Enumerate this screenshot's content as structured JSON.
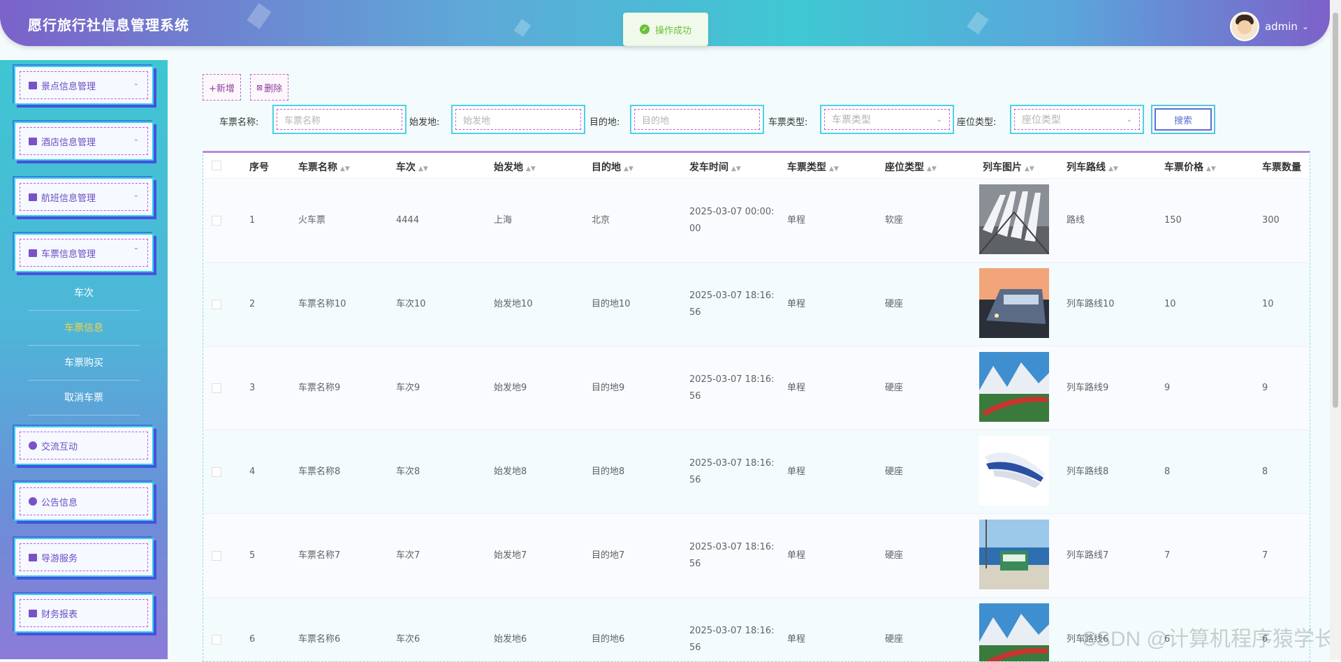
{
  "header": {
    "title": "愿行旅行社信息管理系统",
    "username": "admin"
  },
  "toast": {
    "message": "操作成功"
  },
  "sidebar": {
    "menus": [
      {
        "label": "景点信息管理"
      },
      {
        "label": "酒店信息管理"
      },
      {
        "label": "航班信息管理"
      },
      {
        "label": "车票信息管理"
      }
    ],
    "submenu": [
      "车次",
      "车票信息",
      "车票购买",
      "取消车票"
    ],
    "menus_bottom": [
      {
        "label": "交流互动"
      },
      {
        "label": "公告信息"
      },
      {
        "label": "导游服务"
      },
      {
        "label": "财务报表"
      }
    ]
  },
  "toolbar": {
    "add_label": "+新增",
    "delete_label": "删除"
  },
  "search": {
    "ticket_name_label": "车票名称:",
    "ticket_name_placeholder": "车票名称",
    "origin_label": "始发地:",
    "origin_placeholder": "始发地",
    "destination_label": "目的地:",
    "destination_placeholder": "目的地",
    "ticket_type_label": "车票类型:",
    "ticket_type_placeholder": "车票类型",
    "seat_type_label": "座位类型:",
    "seat_type_placeholder": "座位类型",
    "button_label": "搜索"
  },
  "table": {
    "columns": [
      "序号",
      "车票名称",
      "车次",
      "始发地",
      "目的地",
      "发车时间",
      "车票类型",
      "座位类型",
      "列车图片",
      "列车路线",
      "车票价格",
      "车票数量"
    ],
    "rows": [
      {
        "index": "1",
        "name": "火车票",
        "train": "4444",
        "origin": "上海",
        "dest": "北京",
        "time1": "2025-03-07 00:00:",
        "time2": "00",
        "type": "单程",
        "seat": "软座",
        "route": "路线",
        "price": "150",
        "qty": "300"
      },
      {
        "index": "2",
        "name": "车票名称10",
        "train": "车次10",
        "origin": "始发地10",
        "dest": "目的地10",
        "time1": "2025-03-07 18:16:",
        "time2": "56",
        "type": "单程",
        "seat": "硬座",
        "route": "列车路线10",
        "price": "10",
        "qty": "10"
      },
      {
        "index": "3",
        "name": "车票名称9",
        "train": "车次9",
        "origin": "始发地9",
        "dest": "目的地9",
        "time1": "2025-03-07 18:16:",
        "time2": "56",
        "type": "单程",
        "seat": "硬座",
        "route": "列车路线9",
        "price": "9",
        "qty": "9"
      },
      {
        "index": "4",
        "name": "车票名称8",
        "train": "车次8",
        "origin": "始发地8",
        "dest": "目的地8",
        "time1": "2025-03-07 18:16:",
        "time2": "56",
        "type": "单程",
        "seat": "硬座",
        "route": "列车路线8",
        "price": "8",
        "qty": "8"
      },
      {
        "index": "5",
        "name": "车票名称7",
        "train": "车次7",
        "origin": "始发地7",
        "dest": "目的地7",
        "time1": "2025-03-07 18:16:",
        "time2": "56",
        "type": "单程",
        "seat": "硬座",
        "route": "列车路线7",
        "price": "7",
        "qty": "7"
      },
      {
        "index": "6",
        "name": "车票名称6",
        "train": "车次6",
        "origin": "始发地6",
        "dest": "目的地6",
        "time1": "2025-03-07 18:16:",
        "time2": "56",
        "type": "单程",
        "seat": "硬座",
        "route": "列车路线6",
        "price": "6",
        "qty": "6"
      }
    ]
  },
  "watermark": "CSDN @计算机程序猿学长"
}
